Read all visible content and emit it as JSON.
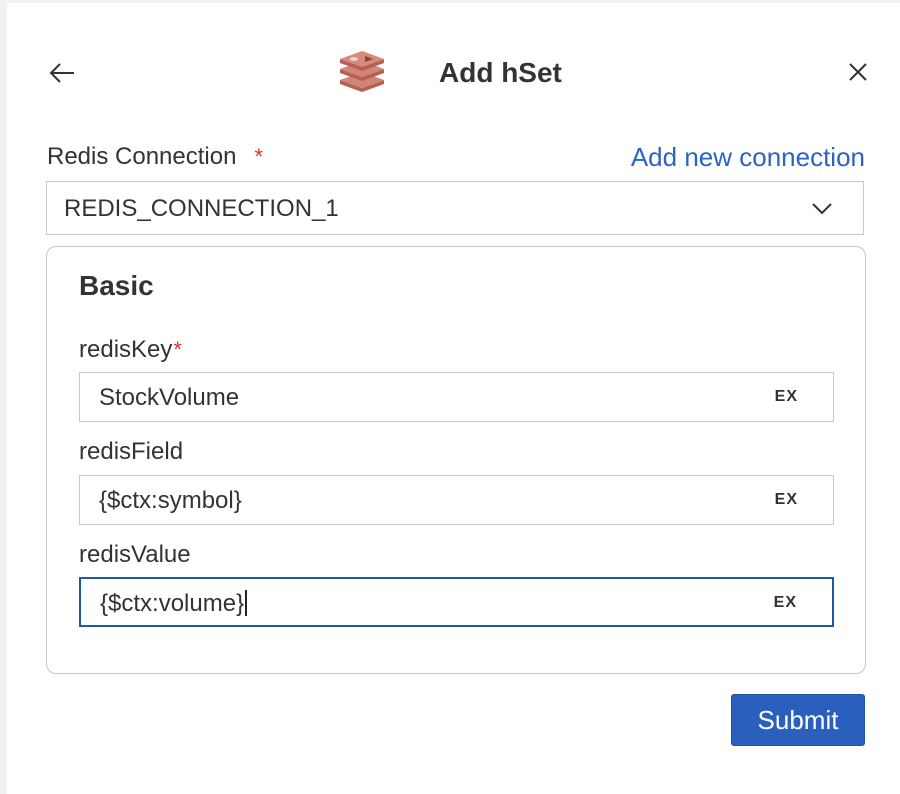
{
  "header": {
    "title": "Add hSet",
    "back_icon": "arrow-left-icon",
    "logo_icon": "redis-logo-icon",
    "close_icon": "close-icon"
  },
  "connection": {
    "label": "Redis Connection",
    "required_mark": "*",
    "add_link": "Add new connection",
    "selected_value": "REDIS_CONNECTION_1",
    "dropdown_icon": "chevron-down-icon"
  },
  "basic": {
    "title": "Basic",
    "fields": [
      {
        "label": "redisKey",
        "required_mark": "*",
        "value": "StockVolume",
        "ex_label": "EX",
        "focused": false
      },
      {
        "label": "redisField",
        "required_mark": "",
        "value": "{$ctx:symbol}",
        "ex_label": "EX",
        "focused": false
      },
      {
        "label": "redisValue",
        "required_mark": "",
        "value": "{$ctx:volume}",
        "ex_label": "EX",
        "focused": true
      }
    ]
  },
  "actions": {
    "submit_label": "Submit"
  },
  "colors": {
    "accent": "#2b5fbd",
    "link": "#2b63c4",
    "required": "#e0312c",
    "focus_border": "#1c5aa8",
    "logo": "#c9786a"
  }
}
